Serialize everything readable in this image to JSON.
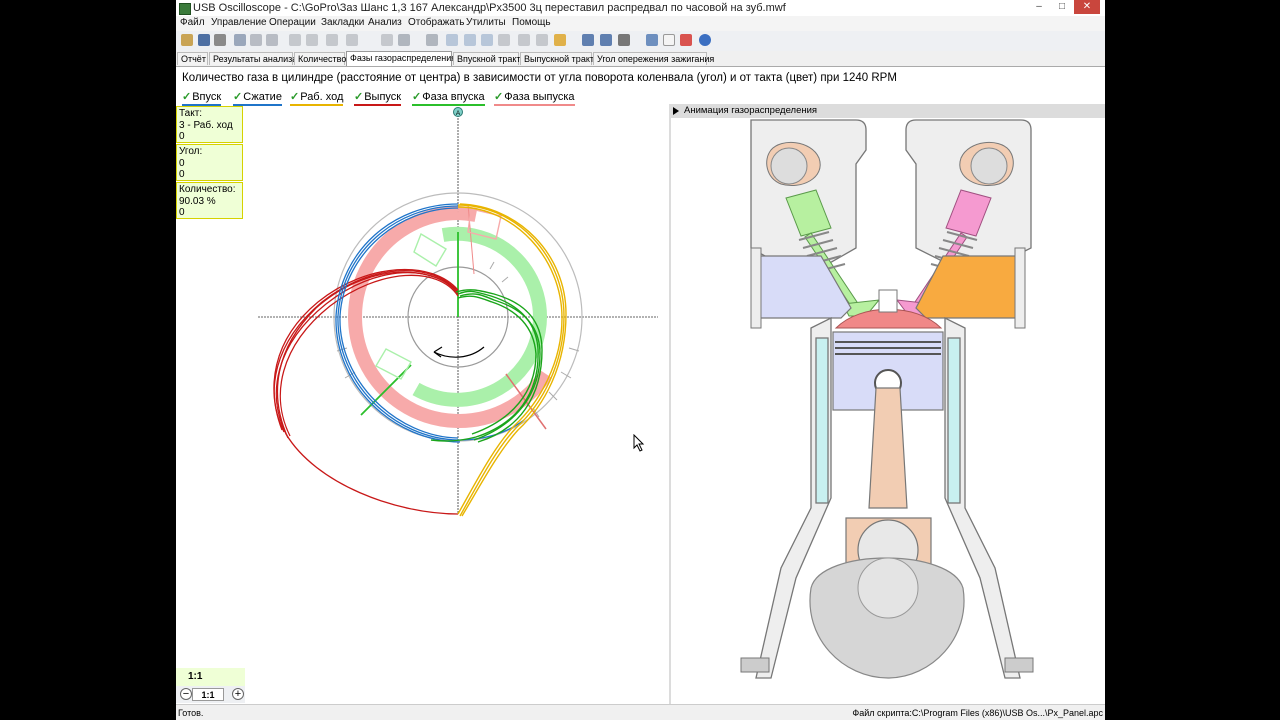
{
  "window": {
    "title": "USB Oscilloscope - C:\\GoPro\\Заз Шанс 1,3 167 Александр\\Px3500 3ц переставил распредвал по часовой на зуб.mwf"
  },
  "menu": [
    "Файл",
    "Управление",
    "Операции",
    "Закладки",
    "Анализ",
    "Отображать",
    "Утилиты",
    "Помощь"
  ],
  "tabs": [
    "Отчёт",
    "Результаты анализа",
    "Количество",
    "Фазы газораспределения",
    "Впускной тракт",
    "Выпускной тракт",
    "Угол опережения зажигания"
  ],
  "active_tab": "Фазы газораспределения",
  "heading": "Количество газа в цилиндре (расстояние от центра) в зависимости от угла поворота коленвала (угол) и от такта (цвет) при 1240 RPM",
  "legend": [
    {
      "label": "Впуск",
      "color": "#1f74c9"
    },
    {
      "label": "Сжатие",
      "color": "#1f74c9"
    },
    {
      "label": "Раб. ход",
      "color": "#e8b400"
    },
    {
      "label": "Выпуск",
      "color": "#c81818"
    },
    {
      "label": "Фаза впуска",
      "color": "#2bbf2b"
    },
    {
      "label": "Фаза выпуска",
      "color": "#f08a8a"
    }
  ],
  "info": {
    "takt": {
      "label": "Такт:",
      "value": "3 - Раб. ход",
      "value2": "0"
    },
    "angle": {
      "label": "Угол:",
      "value": "0",
      "value2": "0"
    },
    "amount": {
      "label": "Количество:",
      "value": "90.03 %",
      "value2": "0"
    }
  },
  "scale_label": "1:1",
  "zoom": {
    "minus": "−",
    "value": "1:1",
    "plus": "+"
  },
  "chart_marker": "A",
  "anim_panel": {
    "title": "Анимация газораспределения"
  },
  "status": {
    "left": "Готов.",
    "right": "Файл скрипта:C:\\Program Files (x86)\\USB Os...\\Px_Panel.apc"
  },
  "colors": {
    "intake": "#1f74c9",
    "power": "#e8b400",
    "exhaust": "#c81818",
    "intake_phase": "#2bbf2b",
    "exhaust_phase": "#f08a8a",
    "infobox": "#efffd6"
  }
}
